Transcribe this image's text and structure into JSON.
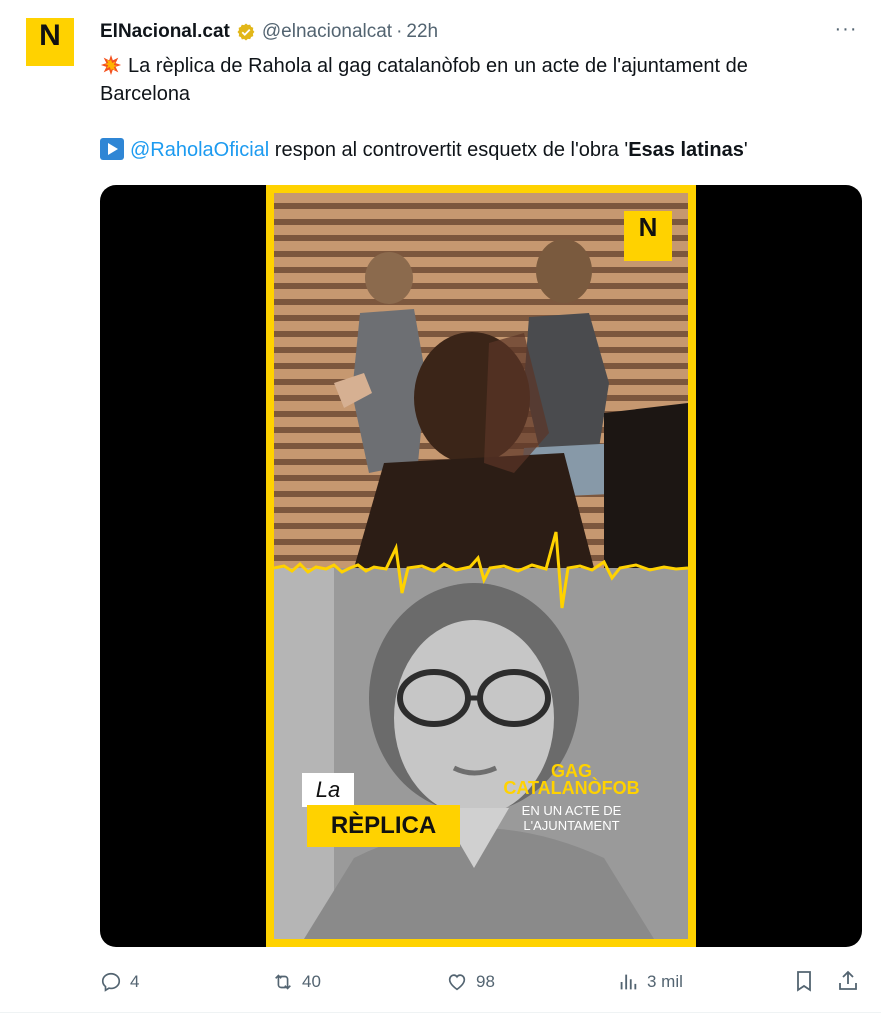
{
  "tweet": {
    "author_name": "ElNacional.cat",
    "handle": "@elnacionalcat",
    "separator": "·",
    "time": "22h",
    "more": "···",
    "avatar_letter": "N",
    "line1": "La rèplica de Rahola al gag catalanòfob en un acte de l'ajuntament de",
    "line2": "Barcelona",
    "mention": "@RaholaOficial",
    "line3_middle": " respon al controvertit esquetx de l'obra '",
    "bold_title": "Esas latinas",
    "line3_end": "'"
  },
  "media": {
    "logo_letter": "N",
    "caption_la": "La",
    "caption_replica": "RÈPLICA",
    "gag_line1": "GAG",
    "gag_line2": "CATALANÒFOB",
    "sub_line1": "EN UN ACTE DE",
    "sub_line2": "L'AJUNTAMENT"
  },
  "actions": {
    "replies": "4",
    "reposts": "40",
    "likes": "98",
    "views": "3 mil"
  },
  "icons": [
    "verified-badge-icon",
    "collision-emoji-icon",
    "play-icon",
    "reply-icon",
    "repost-icon",
    "like-icon",
    "views-icon",
    "bookmark-icon",
    "share-icon"
  ],
  "colors": {
    "brand_yellow": "#ffd200",
    "link_blue": "#1d9bf0",
    "secondary_text": "#536471"
  }
}
